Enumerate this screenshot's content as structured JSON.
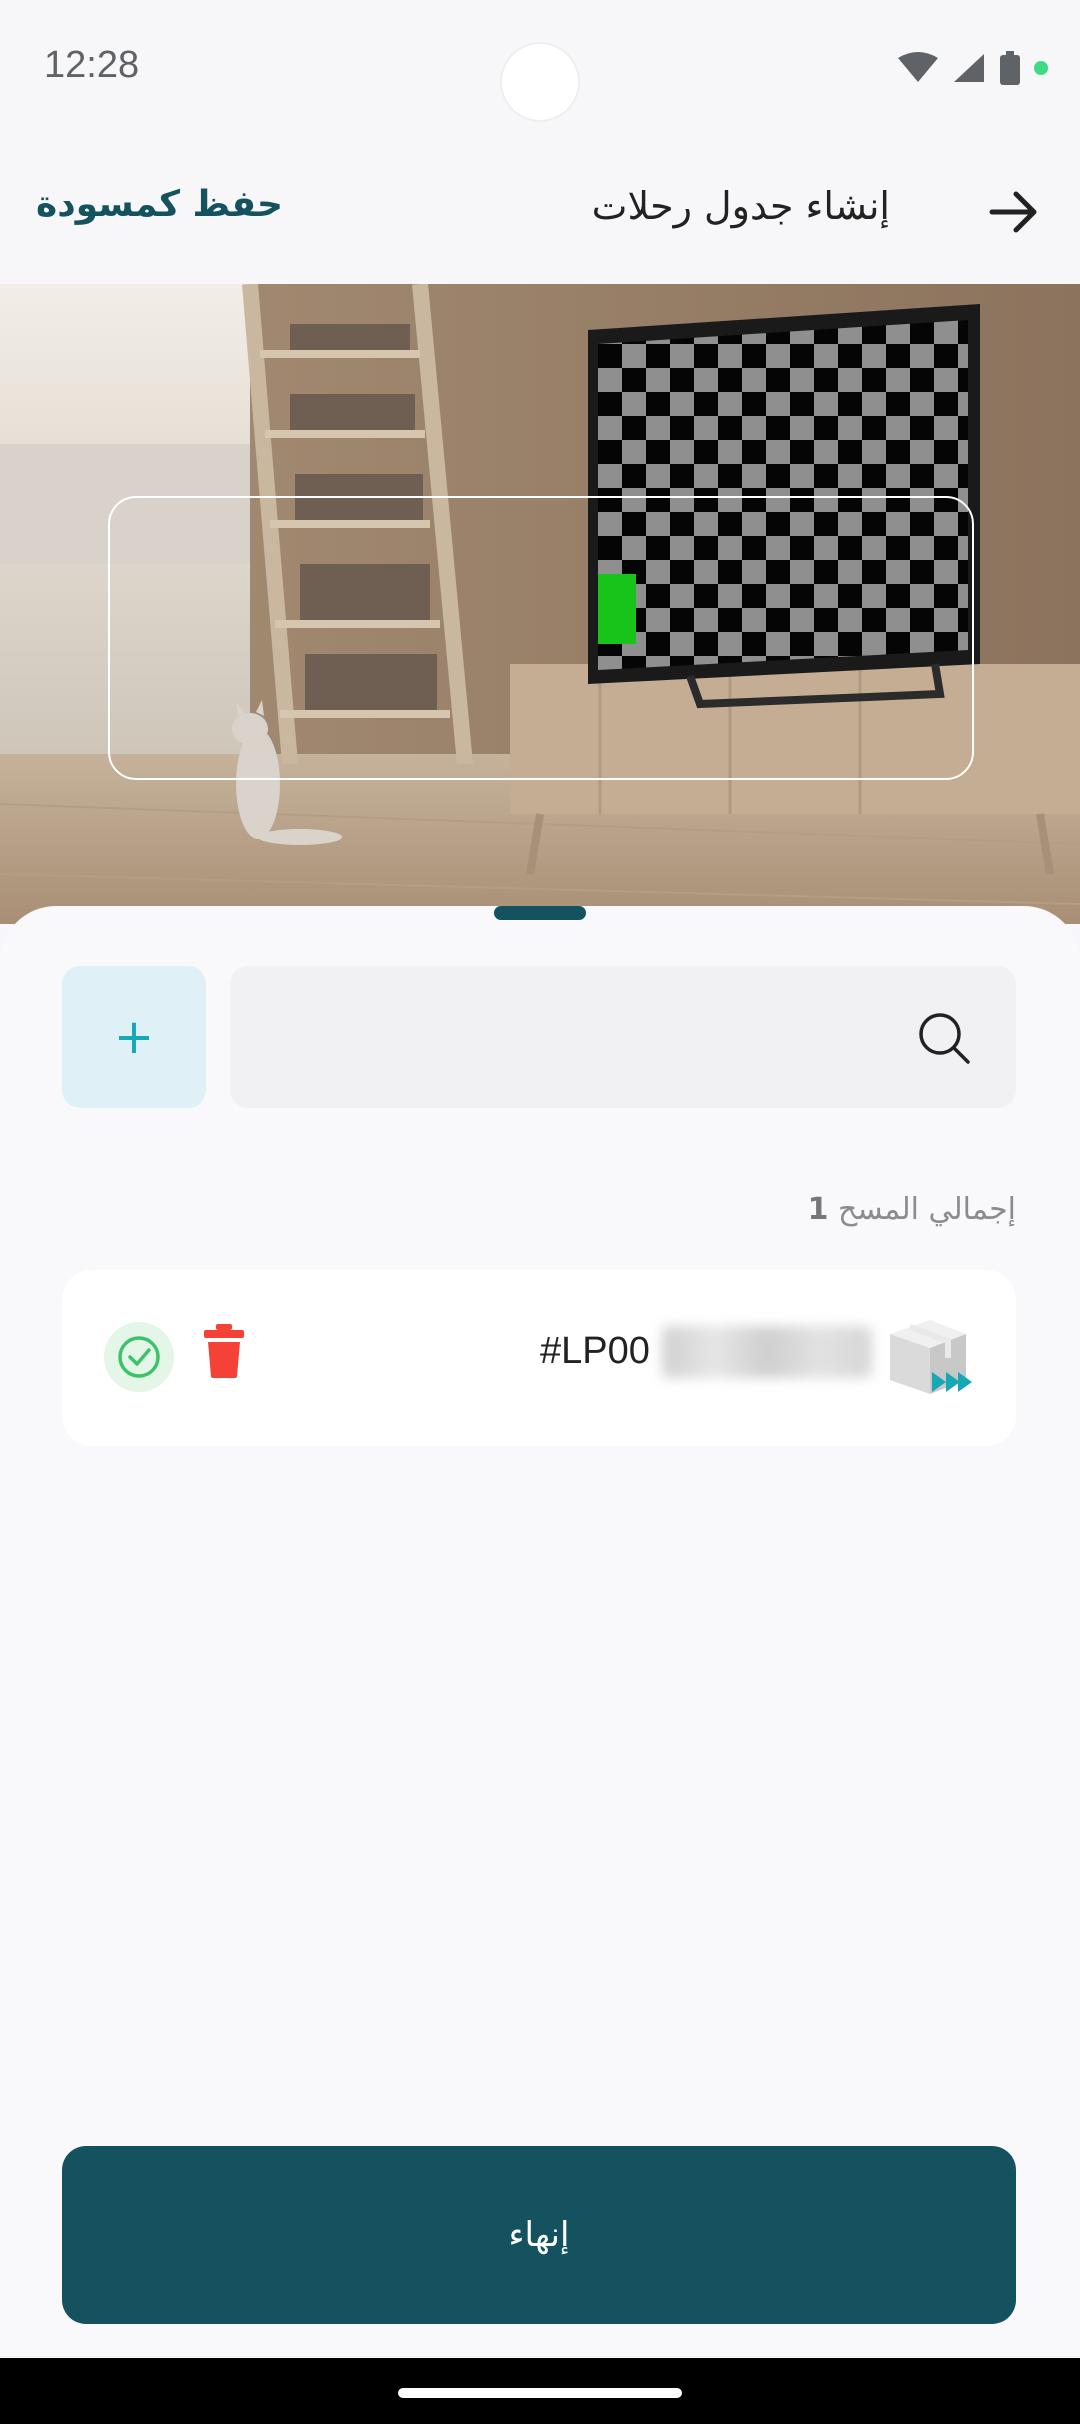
{
  "status_bar": {
    "time": "12:28"
  },
  "app_bar": {
    "title": "إنشاء جدول رحلات",
    "draft_label": "حفظ كمسودة"
  },
  "sheet": {
    "add_label": "+",
    "search": {
      "placeholder": ""
    },
    "total": {
      "label": "إجمالي المسح",
      "count": "1"
    },
    "items": [
      {
        "code_prefix": "#LP00"
      }
    ]
  },
  "footer": {
    "finish_label": "إنهاء"
  },
  "colors": {
    "primary": "#14525f",
    "accent": "#17a8b5",
    "danger": "#f44336",
    "success": "#3cc36a"
  }
}
